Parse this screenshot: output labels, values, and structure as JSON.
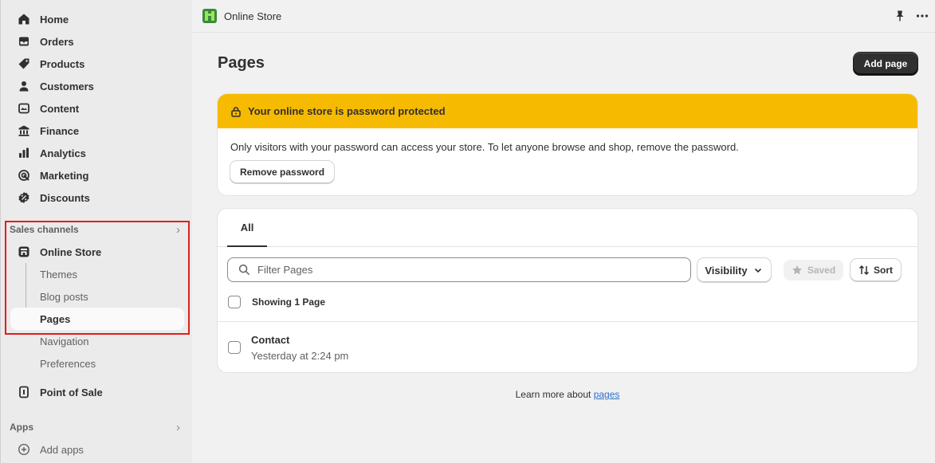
{
  "sidebar": {
    "main_items": [
      {
        "label": "Home",
        "icon": "home-icon"
      },
      {
        "label": "Orders",
        "icon": "inbox-icon"
      },
      {
        "label": "Products",
        "icon": "tag-icon"
      },
      {
        "label": "Customers",
        "icon": "person-icon"
      },
      {
        "label": "Content",
        "icon": "content-icon"
      },
      {
        "label": "Finance",
        "icon": "bank-icon"
      },
      {
        "label": "Analytics",
        "icon": "chart-icon"
      },
      {
        "label": "Marketing",
        "icon": "target-icon"
      },
      {
        "label": "Discounts",
        "icon": "discount-icon"
      }
    ],
    "sales_channels_label": "Sales channels",
    "online_store_label": "Online Store",
    "online_store_sub": [
      "Themes",
      "Blog posts",
      "Pages",
      "Navigation",
      "Preferences"
    ],
    "active_sub": "Pages",
    "pos_label": "Point of Sale",
    "apps_label": "Apps",
    "add_apps_label": "Add apps"
  },
  "topbar": {
    "title": "Online Store"
  },
  "main": {
    "page_title": "Pages",
    "add_page_label": "Add page",
    "banner": {
      "title": "Your online store is password protected",
      "body": "Only visitors with your password can access your store. To let anyone browse and shop, remove the password.",
      "button": "Remove password",
      "color": "#f6ba00"
    },
    "tabs": [
      {
        "label": "All"
      }
    ],
    "search_placeholder": "Filter Pages",
    "visibility_label": "Visibility",
    "saved_label": "Saved",
    "sort_label": "Sort",
    "showing_text": "Showing 1 Page",
    "rows": [
      {
        "title": "Contact",
        "subtitle": "Yesterday at 2:24 pm"
      }
    ],
    "learn_prefix": "Learn more about",
    "learn_link": "pages"
  }
}
